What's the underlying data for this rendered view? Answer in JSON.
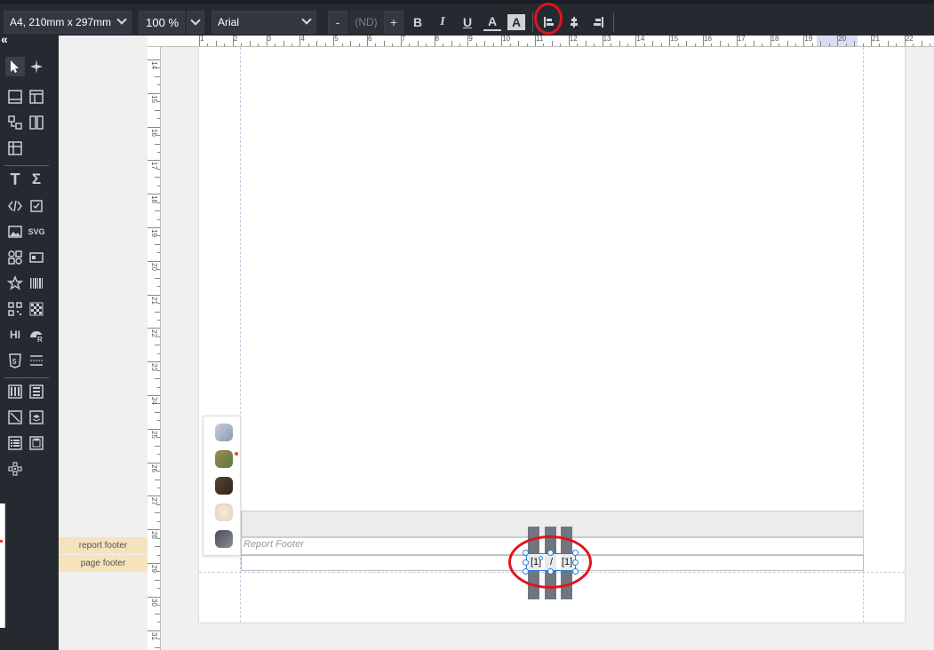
{
  "toolbar": {
    "page_size": "A4, 210mm x 297mm",
    "zoom_value": "100",
    "zoom_unit": "%",
    "font_family": "Arial",
    "font_decrease": "-",
    "font_size": "(ND)",
    "font_increase": "+",
    "bold": "B",
    "italic": "I",
    "underline": "U",
    "font_color": "A",
    "background_color": "A"
  },
  "toolbox": {
    "collapse": "«",
    "text_tool": "T",
    "sum_tool": "Σ",
    "svg_tool": "SVG",
    "hi_tool": "HI"
  },
  "bands": {
    "report_footer": "report footer",
    "page_footer": "page footer",
    "report_footer_title": "Report Footer"
  },
  "ruler": {
    "h_labels": [
      "1",
      "2",
      "3",
      "4",
      "5",
      "6",
      "7",
      "8",
      "9",
      "10",
      "11",
      "12",
      "13",
      "14",
      "15",
      "16",
      "17",
      "18",
      "19",
      "20",
      "21",
      "22"
    ],
    "v_labels": [
      "14",
      "15",
      "16",
      "17",
      "18",
      "19",
      "20",
      "21",
      "22",
      "23",
      "24",
      "25",
      "26",
      "27",
      "28",
      "29",
      "30",
      "31"
    ]
  },
  "footer_field": {
    "page": "[1]",
    "separator": "/",
    "total": "[1]"
  },
  "colors": {
    "toolbar_bg": "#252a31",
    "annotation": "#e0141e",
    "selection": "#2a7fd4",
    "band_label_bg": "#f4e3bd"
  }
}
